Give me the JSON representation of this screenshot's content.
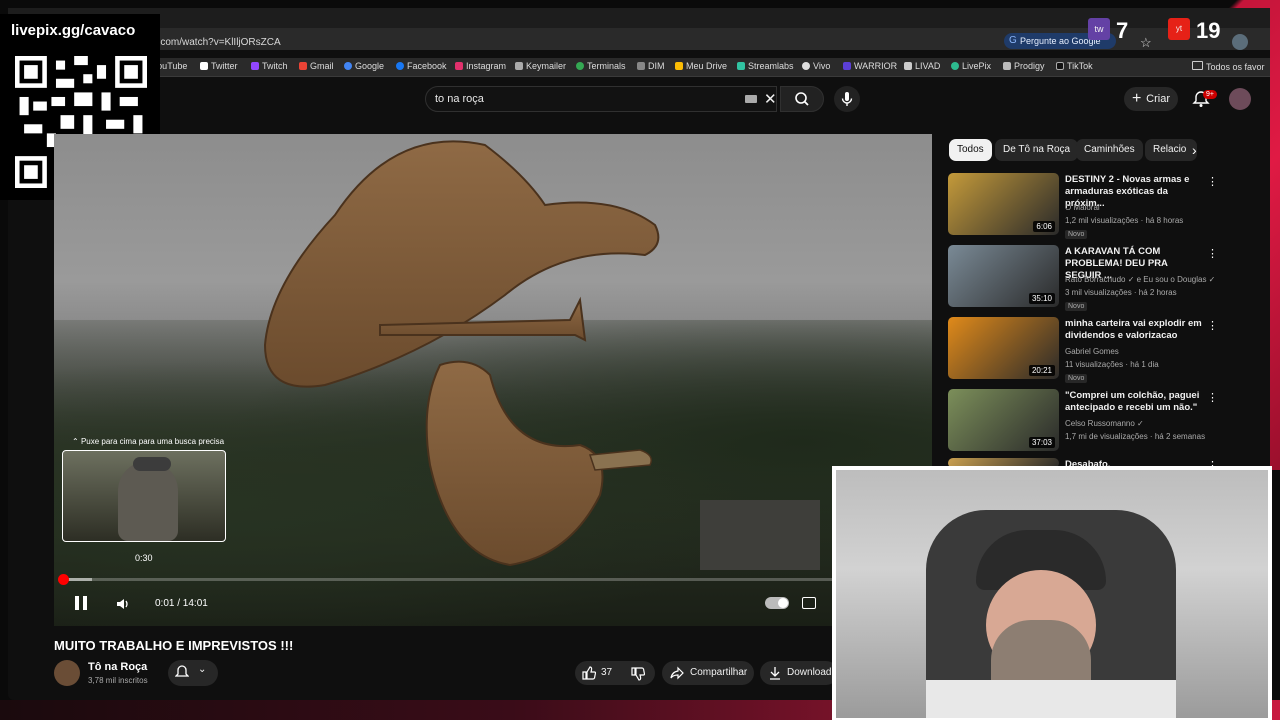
{
  "stream_overlay": {
    "site": "livepix.gg/cavaco",
    "qr_icon": "qr-code-icon",
    "stat_twitch": "7",
    "stat_youtube": "19"
  },
  "browser": {
    "url": "e.com/watch?v=KlIljORsZCA",
    "ask_google": "Pergunte ao Google",
    "bookmarks": [
      "YouTube",
      "Twitter",
      "Twitch",
      "Gmail",
      "Google",
      "Facebook",
      "Instagram",
      "Keymailer",
      "Terminals",
      "DIM",
      "Meu Drive",
      "Streamlabs",
      "Vivo",
      "WARRIOR",
      "LIVAD",
      "LivePix",
      "Prodigy",
      "TikTok"
    ],
    "bookmark_folder": "Todos os favor"
  },
  "youtube": {
    "search_value": "to na roça",
    "create_label": "Criar",
    "notifications": "9+",
    "player": {
      "seek_hint": "Puxe para cima para uma busca precisa",
      "preview_time": "0:30",
      "time": "0:01 / 14:01",
      "progress": 0.001
    },
    "video": {
      "title": "MUITO TRABALHO E IMPREVISTOS !!!",
      "channel": "Tô na Roça",
      "subscribers": "3,78 mil inscritos",
      "likes": "37",
      "share": "Compartilhar",
      "download": "Download"
    },
    "chips": [
      "Todos",
      "De Tô na Roça",
      "Caminhões",
      "Relacio"
    ],
    "related": [
      {
        "title": "DESTINY 2 - Novas armas e armaduras exóticas da próxim...",
        "channel": "O Maioral",
        "meta": "1,2 mil visualizações · há 8 horas",
        "badge": "Novo",
        "duration": "6:06",
        "thumb_color": "#c49a3a"
      },
      {
        "title": "A KARAVAN TÁ COM PROBLEMA! DEU PRA SEGUIR ...",
        "channel": "Rato Borrachudo ✓ e Eu sou o Douglas ✓",
        "meta": "3 mil visualizações · há 2 horas",
        "badge": "Novo",
        "duration": "35:10",
        "thumb_color": "#7a8a96"
      },
      {
        "title": "minha carteira vai explodir em dividendos e valorizacao",
        "channel": "Gabriel Gomes",
        "meta": "11 visualizações · há 1 dia",
        "badge": "Novo",
        "duration": "20:21",
        "thumb_color": "#e08a1a"
      },
      {
        "title": "\"Comprei um colchão, paguei antecipado e recebi um não.\"",
        "channel": "Celso Russomanno ✓",
        "meta": "1,7 mi de visualizações · há 2 semanas",
        "badge": "",
        "duration": "37:03",
        "thumb_color": "#7c8f5a"
      },
      {
        "title": "Desabafo.",
        "channel": "",
        "meta": "",
        "badge": "",
        "duration": "",
        "thumb_color": "#caa050"
      }
    ]
  }
}
